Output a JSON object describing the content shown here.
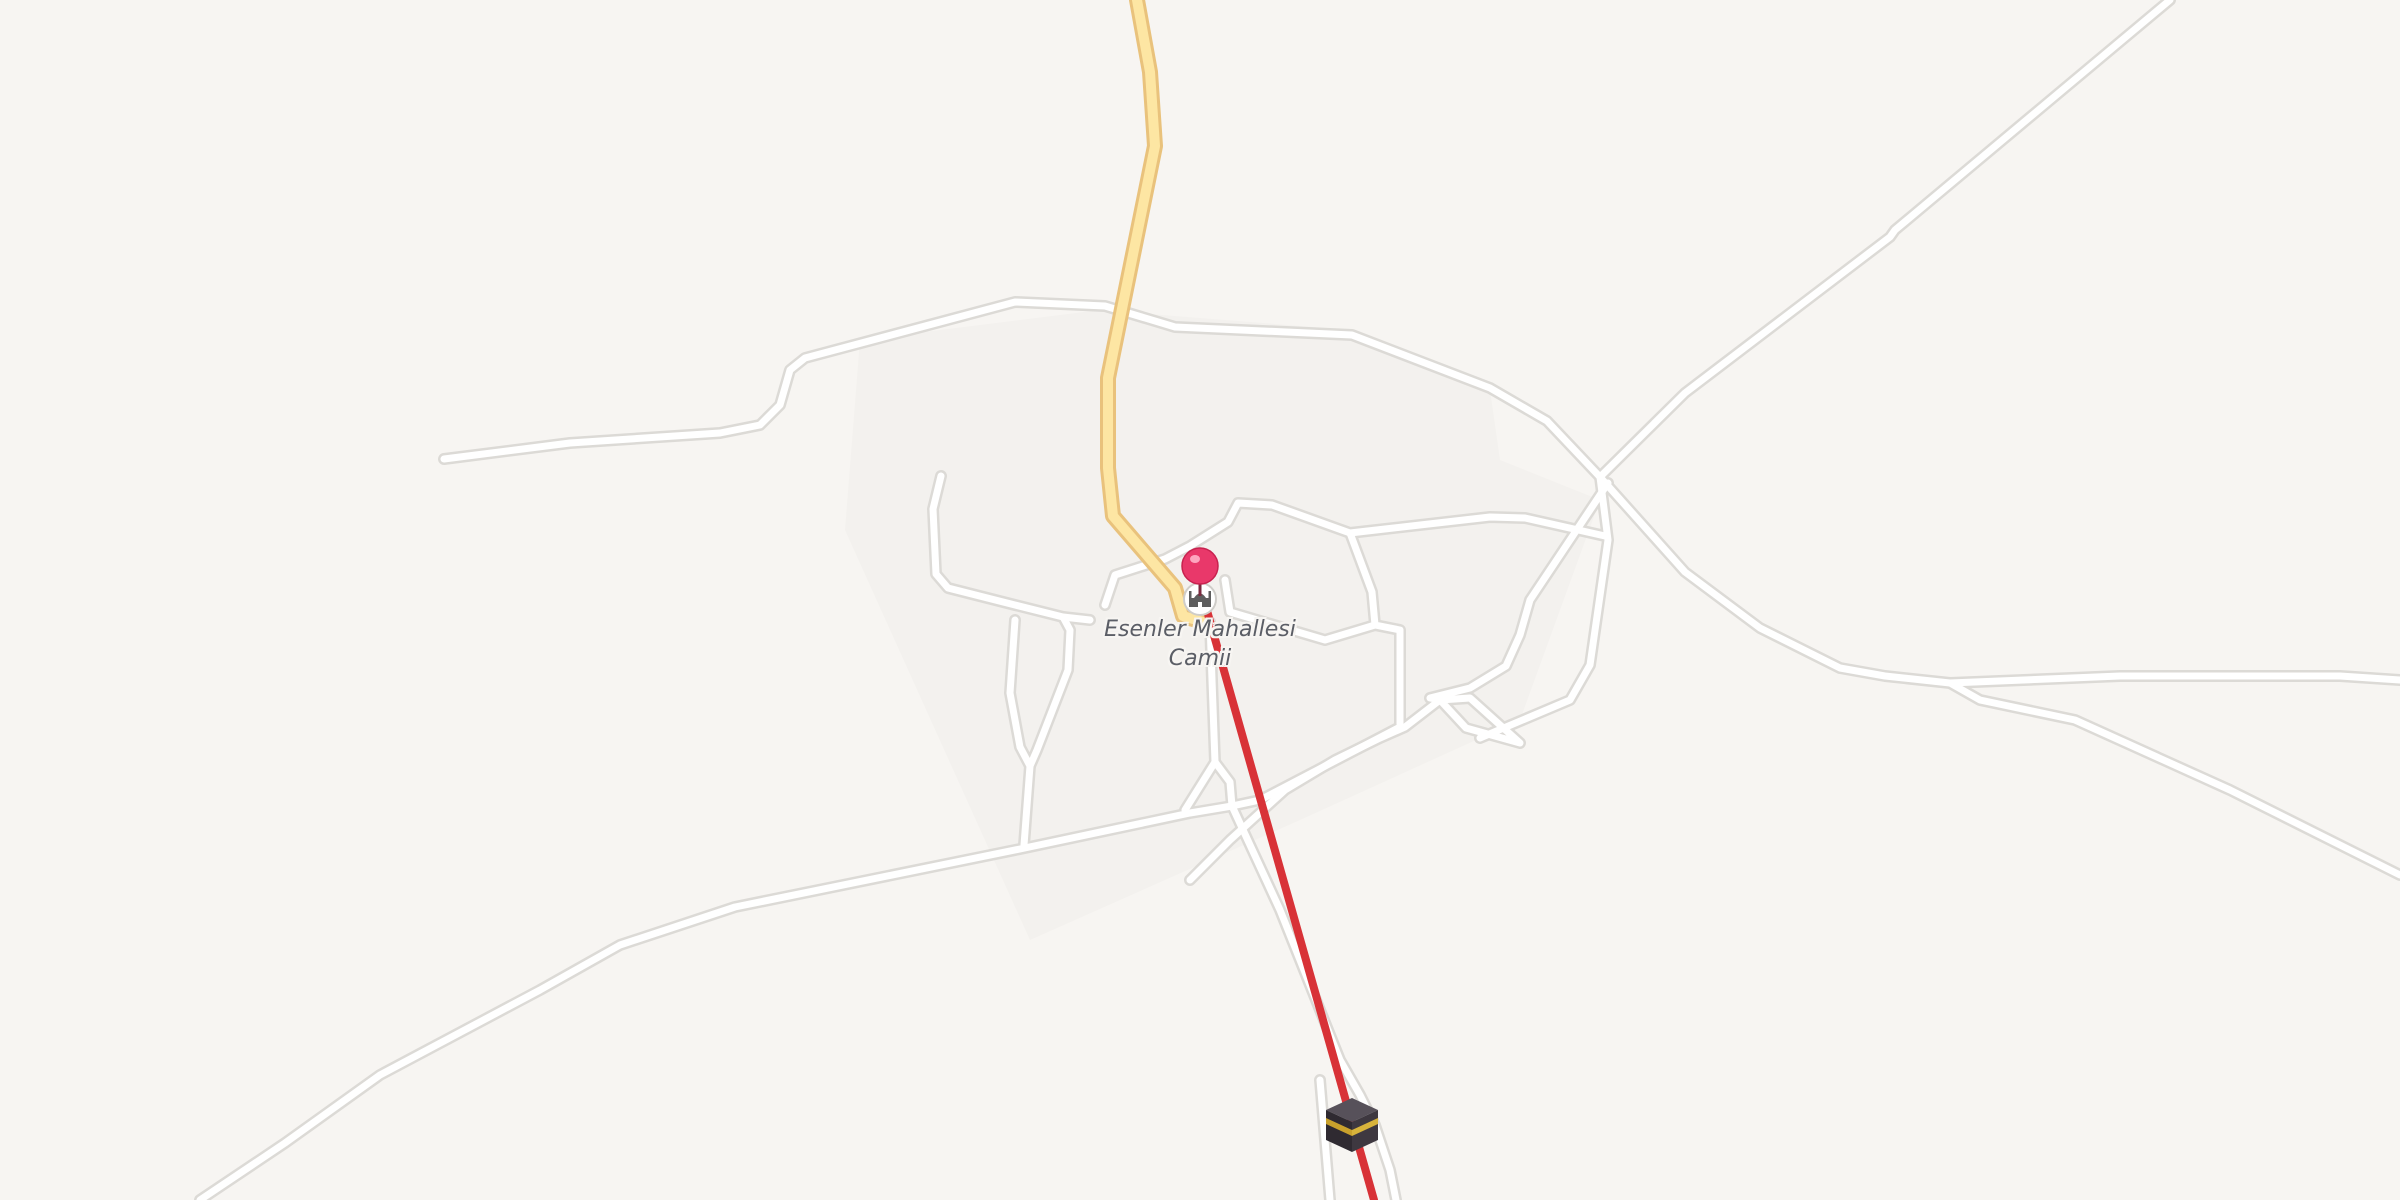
{
  "map": {
    "background_color": "#f7f5f2",
    "settlement_area_color": "#f3f1ee",
    "minor_road_color": "#ffffff",
    "major_road_color": "#fce6a4",
    "route_line_color": "#d83237"
  },
  "poi": {
    "name_line1": "Esenler Mahallesi",
    "name_line2": "Camii",
    "icon": "mosque-icon"
  },
  "location_pin": {
    "icon": "location-pin-icon",
    "color": "#e9386a"
  },
  "destination": {
    "icon": "kaaba-icon"
  }
}
